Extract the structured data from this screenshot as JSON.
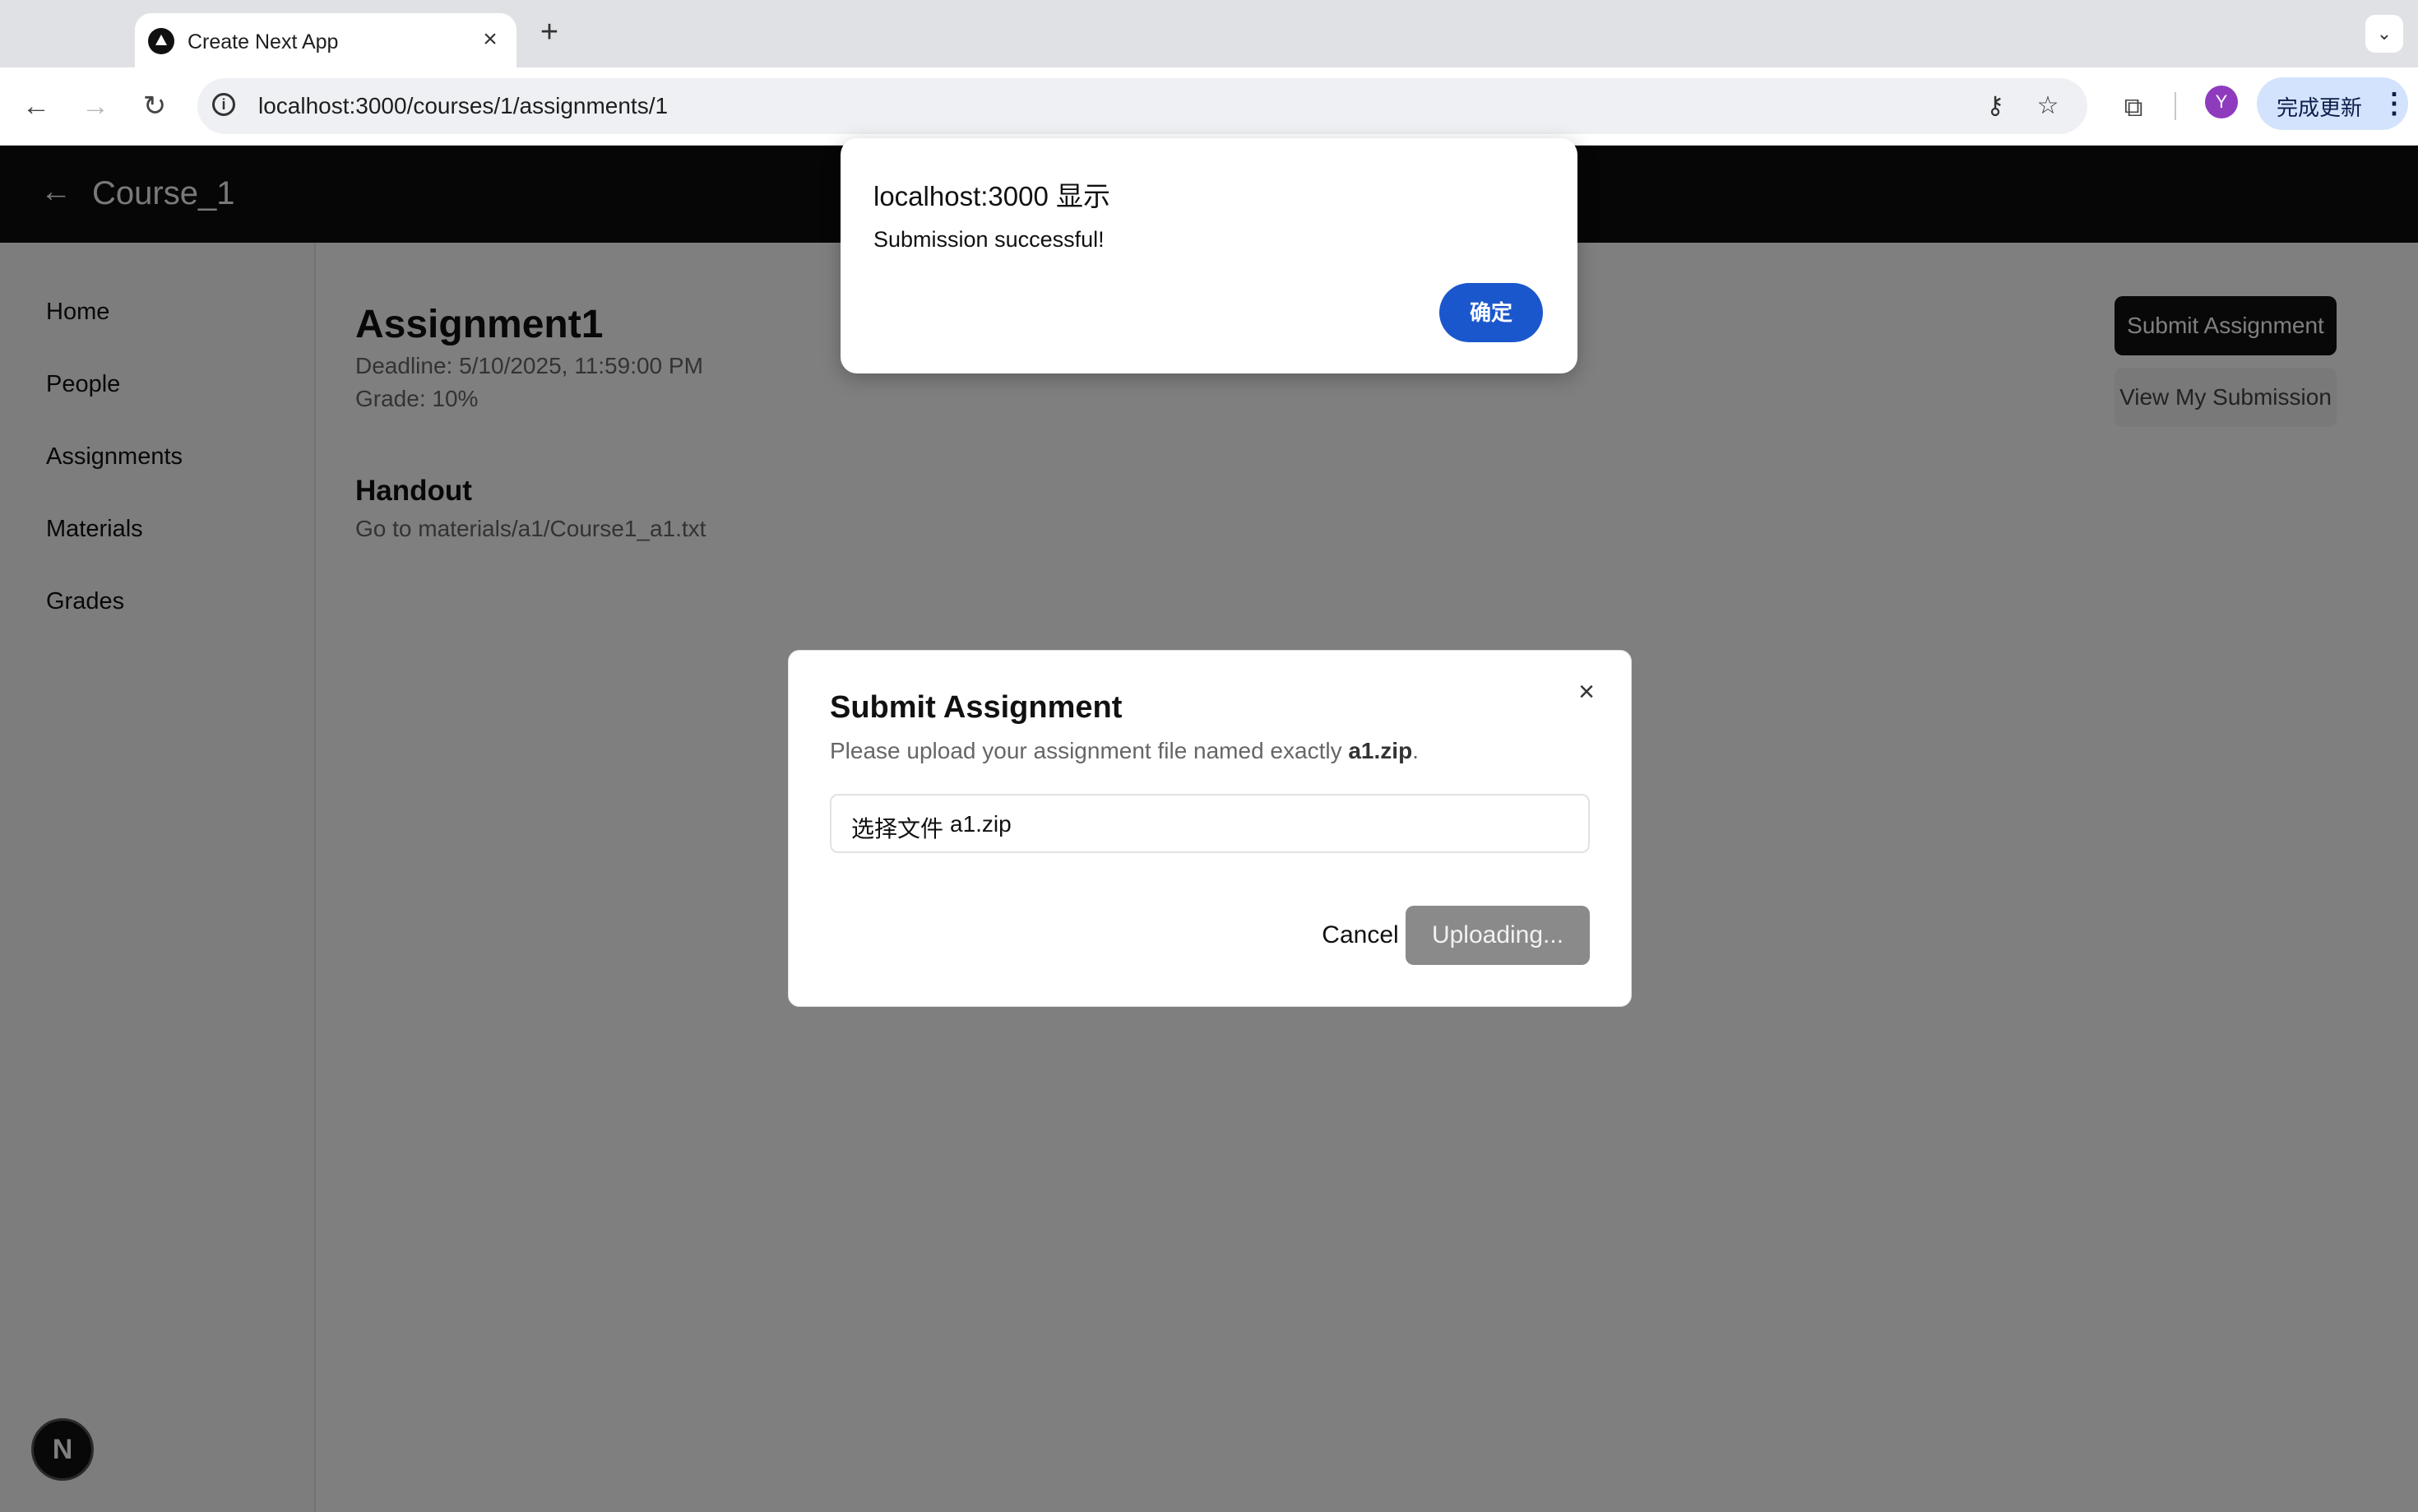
{
  "browser": {
    "tab_title": "Create Next App",
    "tab_close_glyph": "×",
    "new_tab_glyph": "+",
    "tablist_glyph": "⌄",
    "url": "localhost:3000/courses/1/assignments/1",
    "back_glyph": "←",
    "forward_glyph": "→",
    "reload_glyph": "↻",
    "info_glyph": "i",
    "key_glyph": "⚷",
    "star_glyph": "☆",
    "extensions_glyph": "⧉",
    "profile_initial": "Y",
    "update_label": "完成更新",
    "menu_glyph": "⋮"
  },
  "header": {
    "back_glyph": "←",
    "course_title": "Course_1"
  },
  "sidebar": {
    "items": [
      {
        "label": "Home"
      },
      {
        "label": "People"
      },
      {
        "label": "Assignments"
      },
      {
        "label": "Materials"
      },
      {
        "label": "Grades"
      }
    ]
  },
  "assignment": {
    "title": "Assignment1",
    "deadline": "Deadline: 5/10/2025, 11:59:00 PM",
    "grade": "Grade: 10%",
    "handout_title": "Handout",
    "handout_text": "Go to materials/a1/Course1_a1.txt",
    "submit_label": "Submit Assignment",
    "view_submission_label": "View My Submission"
  },
  "modal": {
    "title": "Submit Assignment",
    "desc_prefix": "Please upload your assignment file named exactly ",
    "desc_filename": "a1.zip",
    "desc_suffix": ".",
    "file_button": "选择文件",
    "file_name": "a1.zip",
    "close_glyph": "×",
    "cancel_label": "Cancel",
    "upload_label": "Uploading..."
  },
  "alert": {
    "title": "localhost:3000 显示",
    "message": "Submission successful!",
    "ok_label": "确定"
  },
  "next_badge": "N",
  "colors": {
    "header_bg": "#0c0c0c",
    "primary_button": "#111111",
    "alert_ok": "#1b57cc",
    "avatar": "#8e3bbd",
    "update_chip": "#d3e3fd",
    "overlay": "rgba(0,0,0,0.5)"
  }
}
